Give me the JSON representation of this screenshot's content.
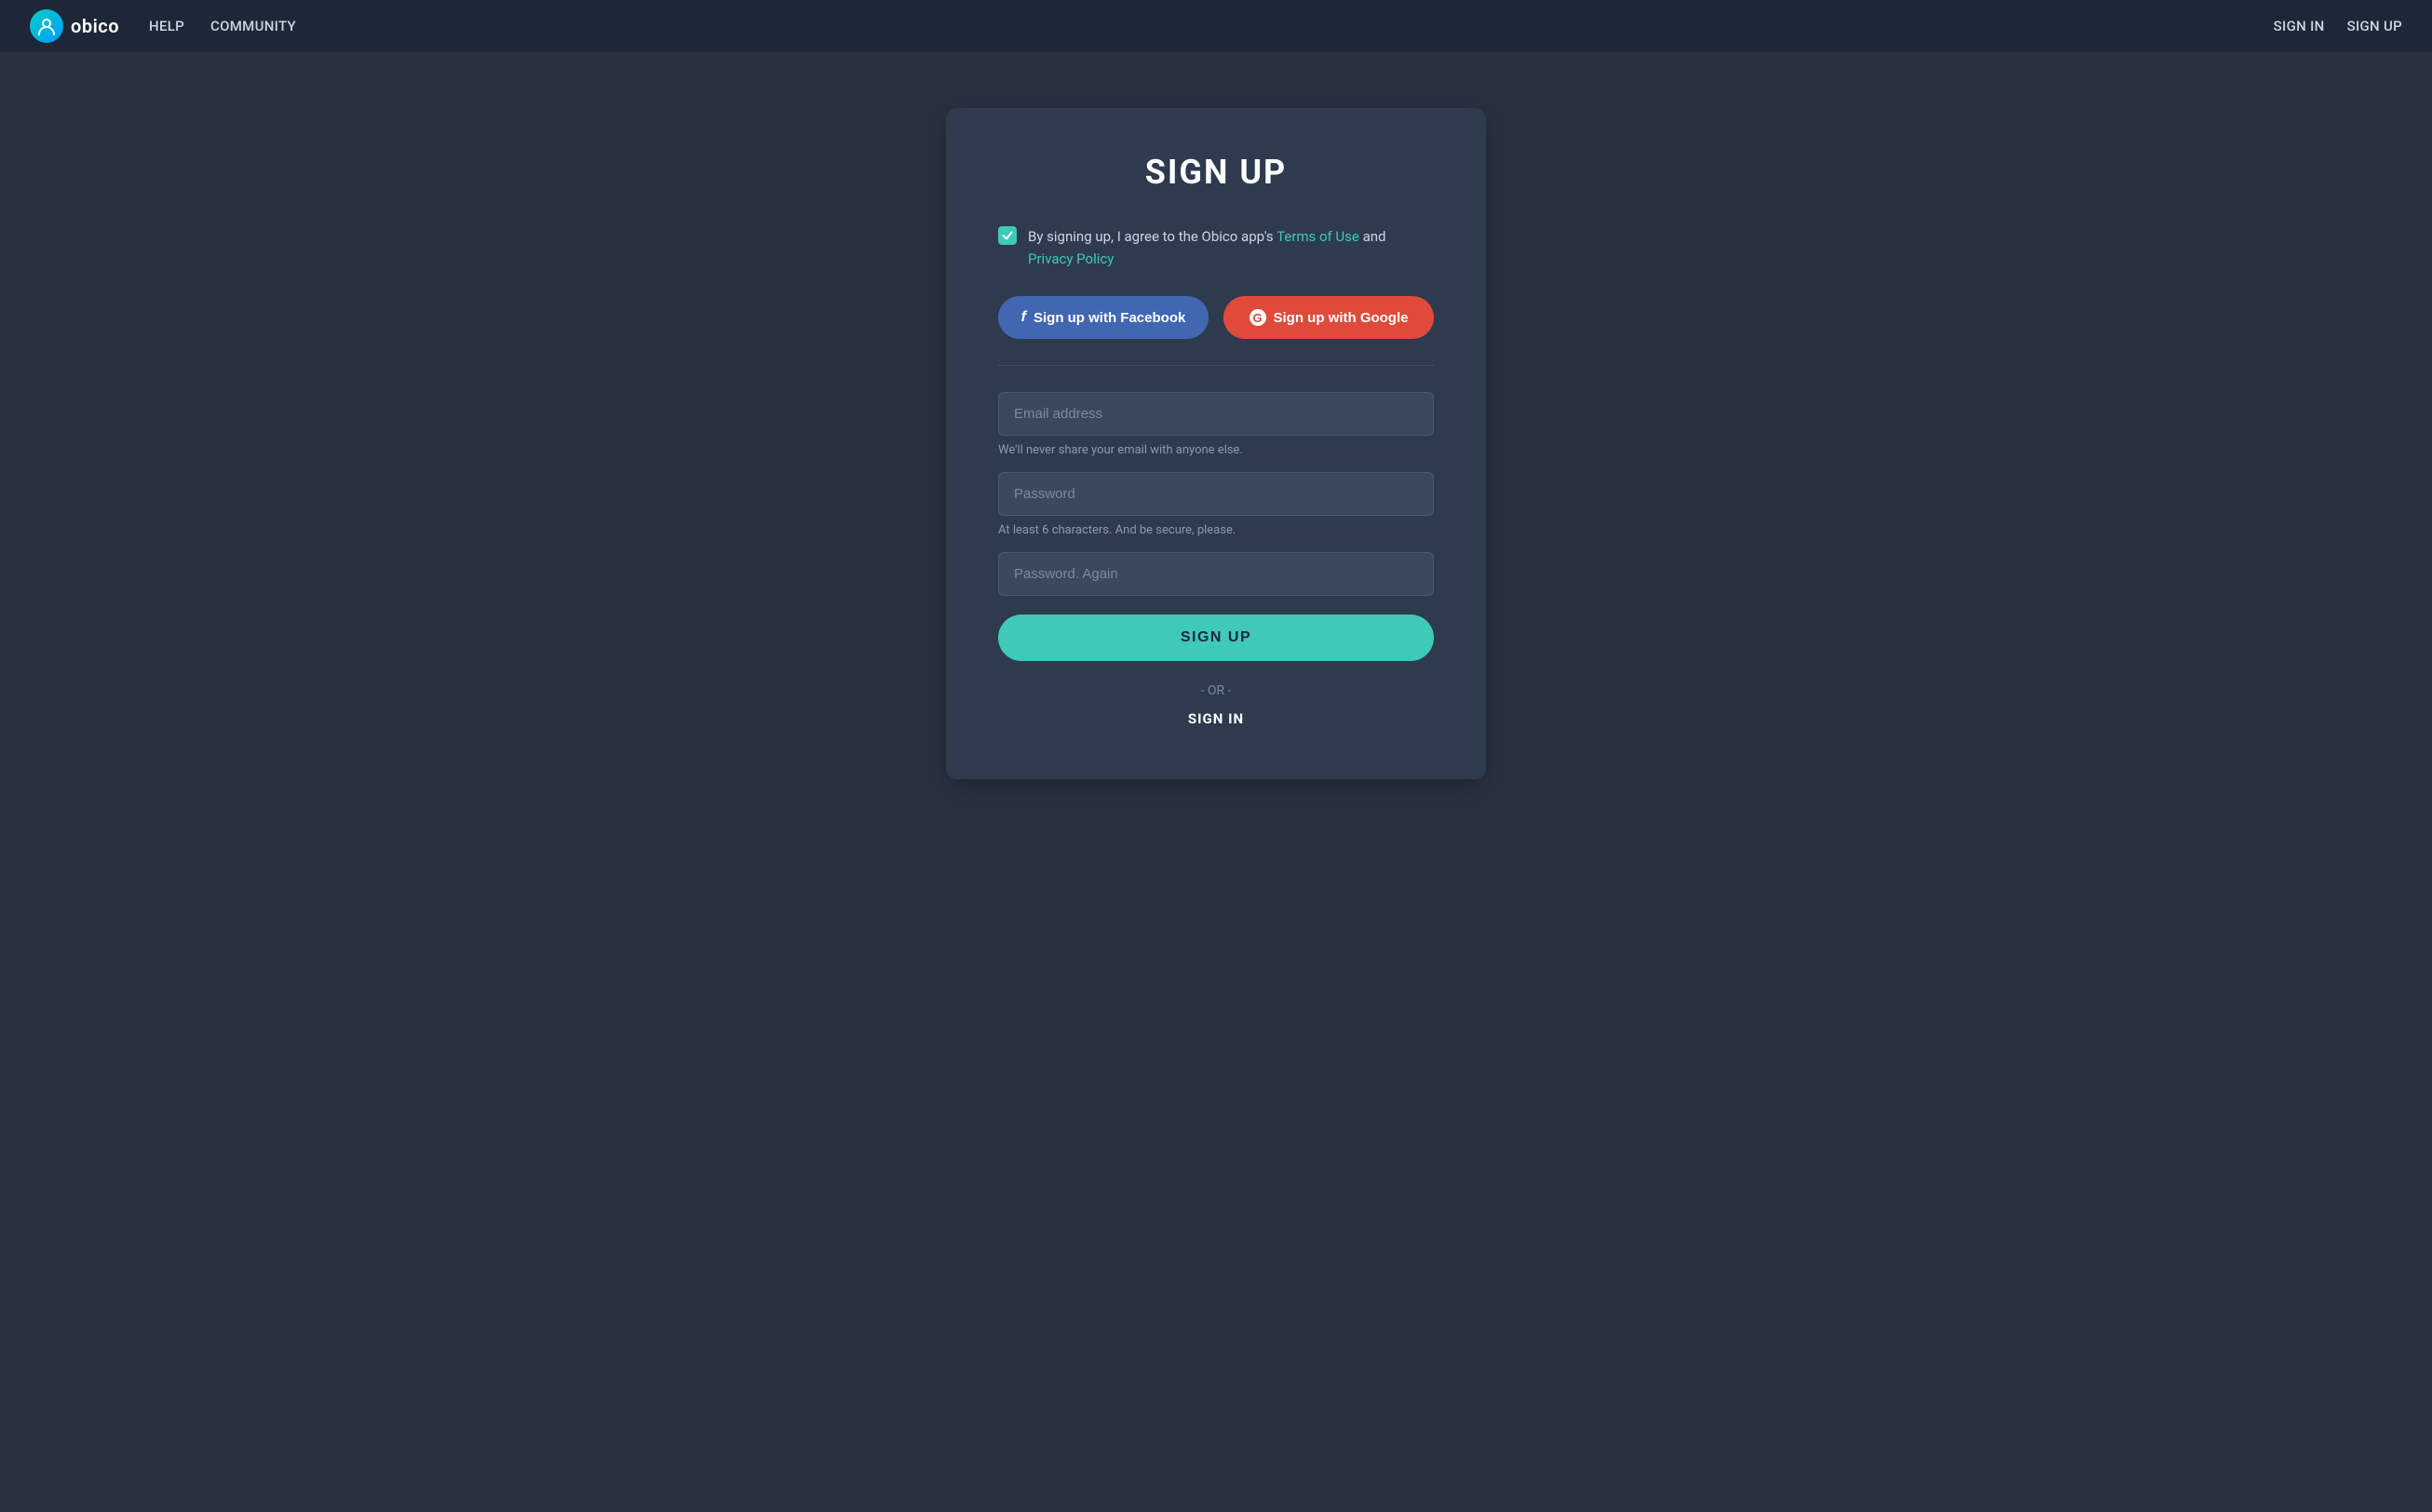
{
  "nav": {
    "logo_text": "obico",
    "links": [
      {
        "label": "HELP",
        "href": "#"
      },
      {
        "label": "COMMUNITY",
        "href": "#"
      }
    ],
    "right_links": [
      {
        "label": "SIGN IN",
        "href": "#"
      },
      {
        "label": "SIGN UP",
        "href": "#"
      }
    ]
  },
  "card": {
    "title": "SIGN UP",
    "terms_text_before": "By signing up, I agree to the Obico app's ",
    "terms_link1": "Terms of Use",
    "terms_text_middle": " and ",
    "terms_link2": "Privacy Policy",
    "facebook_button": "Sign up with Facebook",
    "google_button": "Sign up with Google",
    "email_placeholder": "Email address",
    "email_hint": "We'll never share your email with anyone else.",
    "password_placeholder": "Password",
    "password_hint": "At least 6 characters. And be secure, please.",
    "password2_placeholder": "Password. Again",
    "signup_button": "SIGN UP",
    "or_text": "- OR -",
    "signin_link": "SIGN IN"
  }
}
